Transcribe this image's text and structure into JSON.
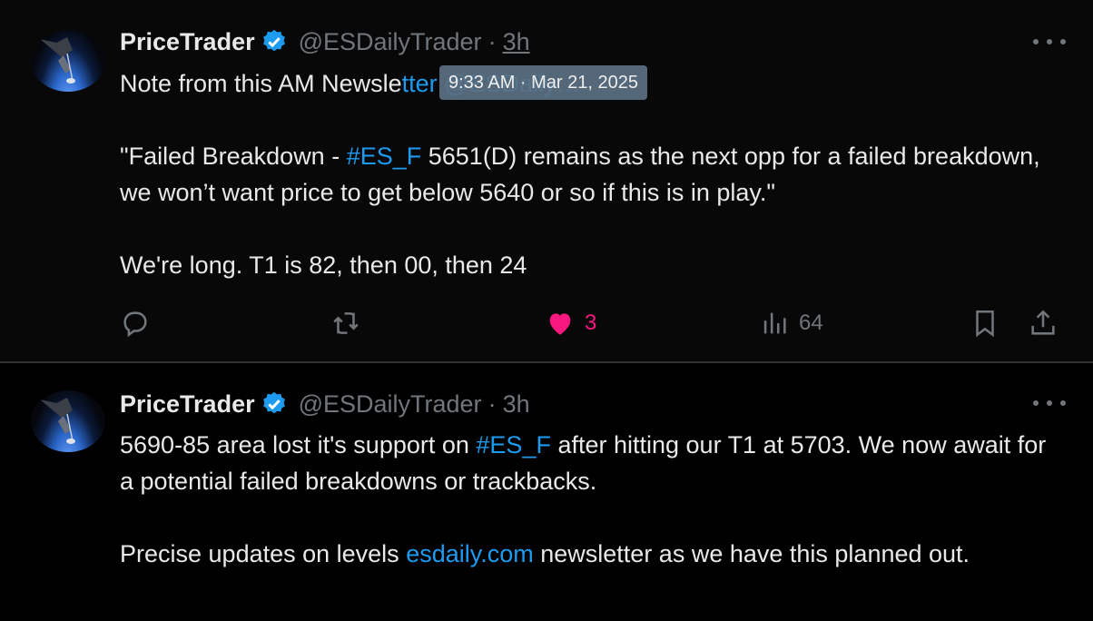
{
  "tweets": [
    {
      "author_name": "PriceTrader",
      "handle": "@ESDailyTrader",
      "separator": "·",
      "time": "3h",
      "tooltip": "9:33 AM · Mar 21, 2025",
      "line1_prefix": "Note from this AM Newsle",
      "line1_hidden": "tter @ESDaily…",
      "para2_quote_open": "\"Failed Breakdown - ",
      "para2_hashtag": "#ES_F",
      "para2_rest": " 5651(D) remains as the next opp for a failed breakdown, we won’t want price to get below 5640 or so if this is in play.\"",
      "para3": "We're long. T1 is 82, then 00, then 24",
      "likes": "3",
      "views": "64"
    },
    {
      "author_name": "PriceTrader",
      "handle": "@ESDailyTrader",
      "separator": "·",
      "time": "3h",
      "para1_pre": "5690-85 area lost it's support on ",
      "para1_hashtag": "#ES_F",
      "para1_post": " after hitting our T1 at 5703. We now await for a potential failed breakdowns or trackbacks.",
      "para2_pre": "Precise updates on levels ",
      "para2_link": "esdaily.com",
      "para2_post": " newsletter as we have this planned out."
    }
  ],
  "icons": [
    "verified-badge-icon",
    "more-icon",
    "reply-icon",
    "retweet-icon",
    "heart-icon",
    "views-icon",
    "bookmark-icon",
    "share-icon"
  ],
  "colors": {
    "accent": "#1d9bf0",
    "like": "#f91880",
    "muted": "#71767b",
    "text": "#e7e9ea"
  }
}
